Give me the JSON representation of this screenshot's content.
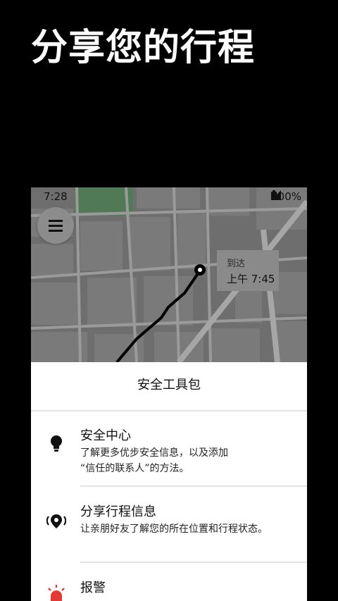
{
  "promo": {
    "title": "分享您的行程"
  },
  "status_bar": {
    "time": "7:28",
    "battery": "100%"
  },
  "map": {
    "arrival_label": "到达",
    "arrival_time": "上午 7:45"
  },
  "sheet": {
    "title": "安全工具包",
    "items": [
      {
        "title": "安全中心",
        "description_line1": "了解更多优步安全信息，以及添加",
        "description_line2": "“信任的联系人”的方法。",
        "icon": "lightbulb-icon"
      },
      {
        "title": "分享行程信息",
        "description": "让亲朋好友了解您的所在位置和行程状态。",
        "icon": "location-broadcast-icon"
      },
      {
        "title": "报警",
        "icon": "siren-icon"
      }
    ]
  },
  "colors": {
    "background": "#000000",
    "map": "#6e6e6e",
    "park": "#4f7a55",
    "route": "#000000",
    "alert": "#e53935"
  }
}
